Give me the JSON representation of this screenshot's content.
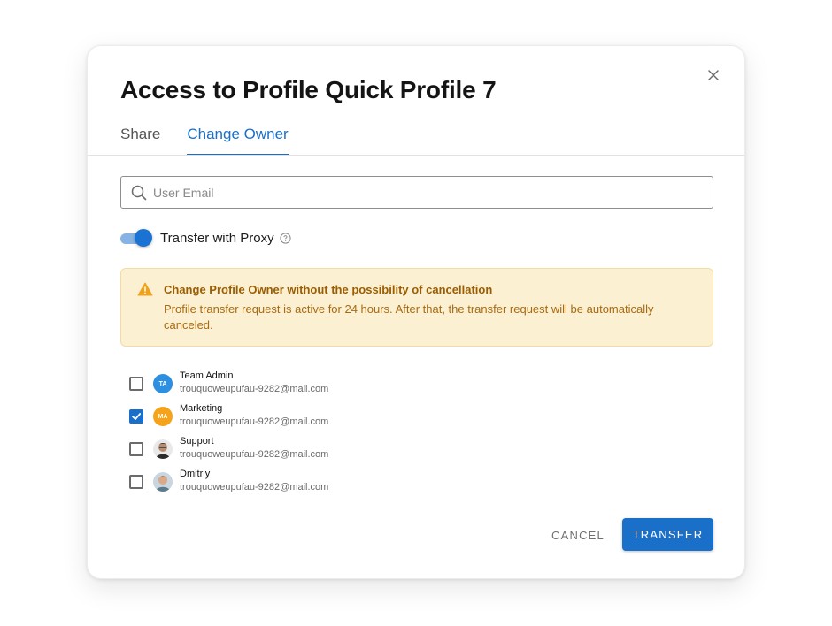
{
  "dialog": {
    "title": "Access to Profile Quick Profile 7",
    "close_icon": "close-icon"
  },
  "tabs": [
    {
      "label": "Share",
      "active": false
    },
    {
      "label": "Change Owner",
      "active": true
    }
  ],
  "search": {
    "placeholder": "User Email",
    "value": "",
    "icon": "search-icon"
  },
  "proxy_toggle": {
    "label": "Transfer with Proxy",
    "checked": true,
    "help_icon": "help-circle-icon"
  },
  "alert": {
    "icon": "warning-icon",
    "title": "Change Profile Owner without the possibility of cancellation",
    "text": "Profile transfer request is active for 24 hours. After that, the transfer request will be automatically canceled."
  },
  "users": [
    {
      "name": "Team Admin",
      "email": "trouquoweupufau-9282@mail.com",
      "initials": "TA",
      "avatar_color": "#2d8fe0",
      "checked": false
    },
    {
      "name": "Marketing",
      "email": "trouquoweupufau-9282@mail.com",
      "initials": "MA",
      "avatar_color": "#f5a31a",
      "checked": true
    },
    {
      "name": "Support",
      "email": "trouquoweupufau-9282@mail.com",
      "initials": "",
      "avatar_color": "#3a3a3a",
      "checked": false
    },
    {
      "name": "Dmitriy",
      "email": "trouquoweupufau-9282@mail.com",
      "initials": "",
      "avatar_color": "#9bb3c4",
      "checked": false
    }
  ],
  "actions": {
    "cancel_label": "CANCEL",
    "transfer_label": "TRANSFER"
  },
  "colors": {
    "accent": "#1a6fc9",
    "warning_bg": "#fcf0d3",
    "warning_text": "#9b5d00"
  }
}
